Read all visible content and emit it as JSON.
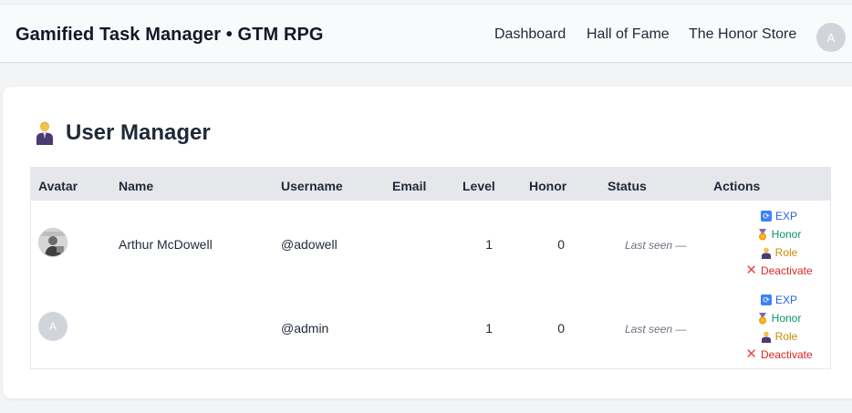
{
  "header": {
    "brand": "Gamified Task Manager • GTM RPG",
    "nav": [
      {
        "label": "Dashboard"
      },
      {
        "label": "Hall of Fame"
      },
      {
        "label": "The Honor Store"
      }
    ],
    "avatar_initial": "A"
  },
  "page": {
    "title": "User Manager",
    "title_icon": "office-worker-icon"
  },
  "table": {
    "columns": [
      "Avatar",
      "Name",
      "Username",
      "Email",
      "Level",
      "Honor",
      "Status",
      "Actions"
    ],
    "rows": [
      {
        "avatar": "photo",
        "name": "Arthur McDowell",
        "username": "@adowell",
        "email": "",
        "level": "1",
        "honor": "0",
        "status": "Last seen —"
      },
      {
        "avatar_initial": "A",
        "name": "",
        "username": "@admin",
        "email": "",
        "level": "1",
        "honor": "0",
        "status": "Last seen —"
      }
    ],
    "actions": {
      "exp": "EXP",
      "honor": "Honor",
      "role": "Role",
      "deactivate": "Deactivate"
    }
  },
  "colors": {
    "exp": "#2563eb",
    "honor": "#059669",
    "role": "#ca8a04",
    "deactivate": "#dc2626",
    "header_row": "#e5e7eb"
  }
}
